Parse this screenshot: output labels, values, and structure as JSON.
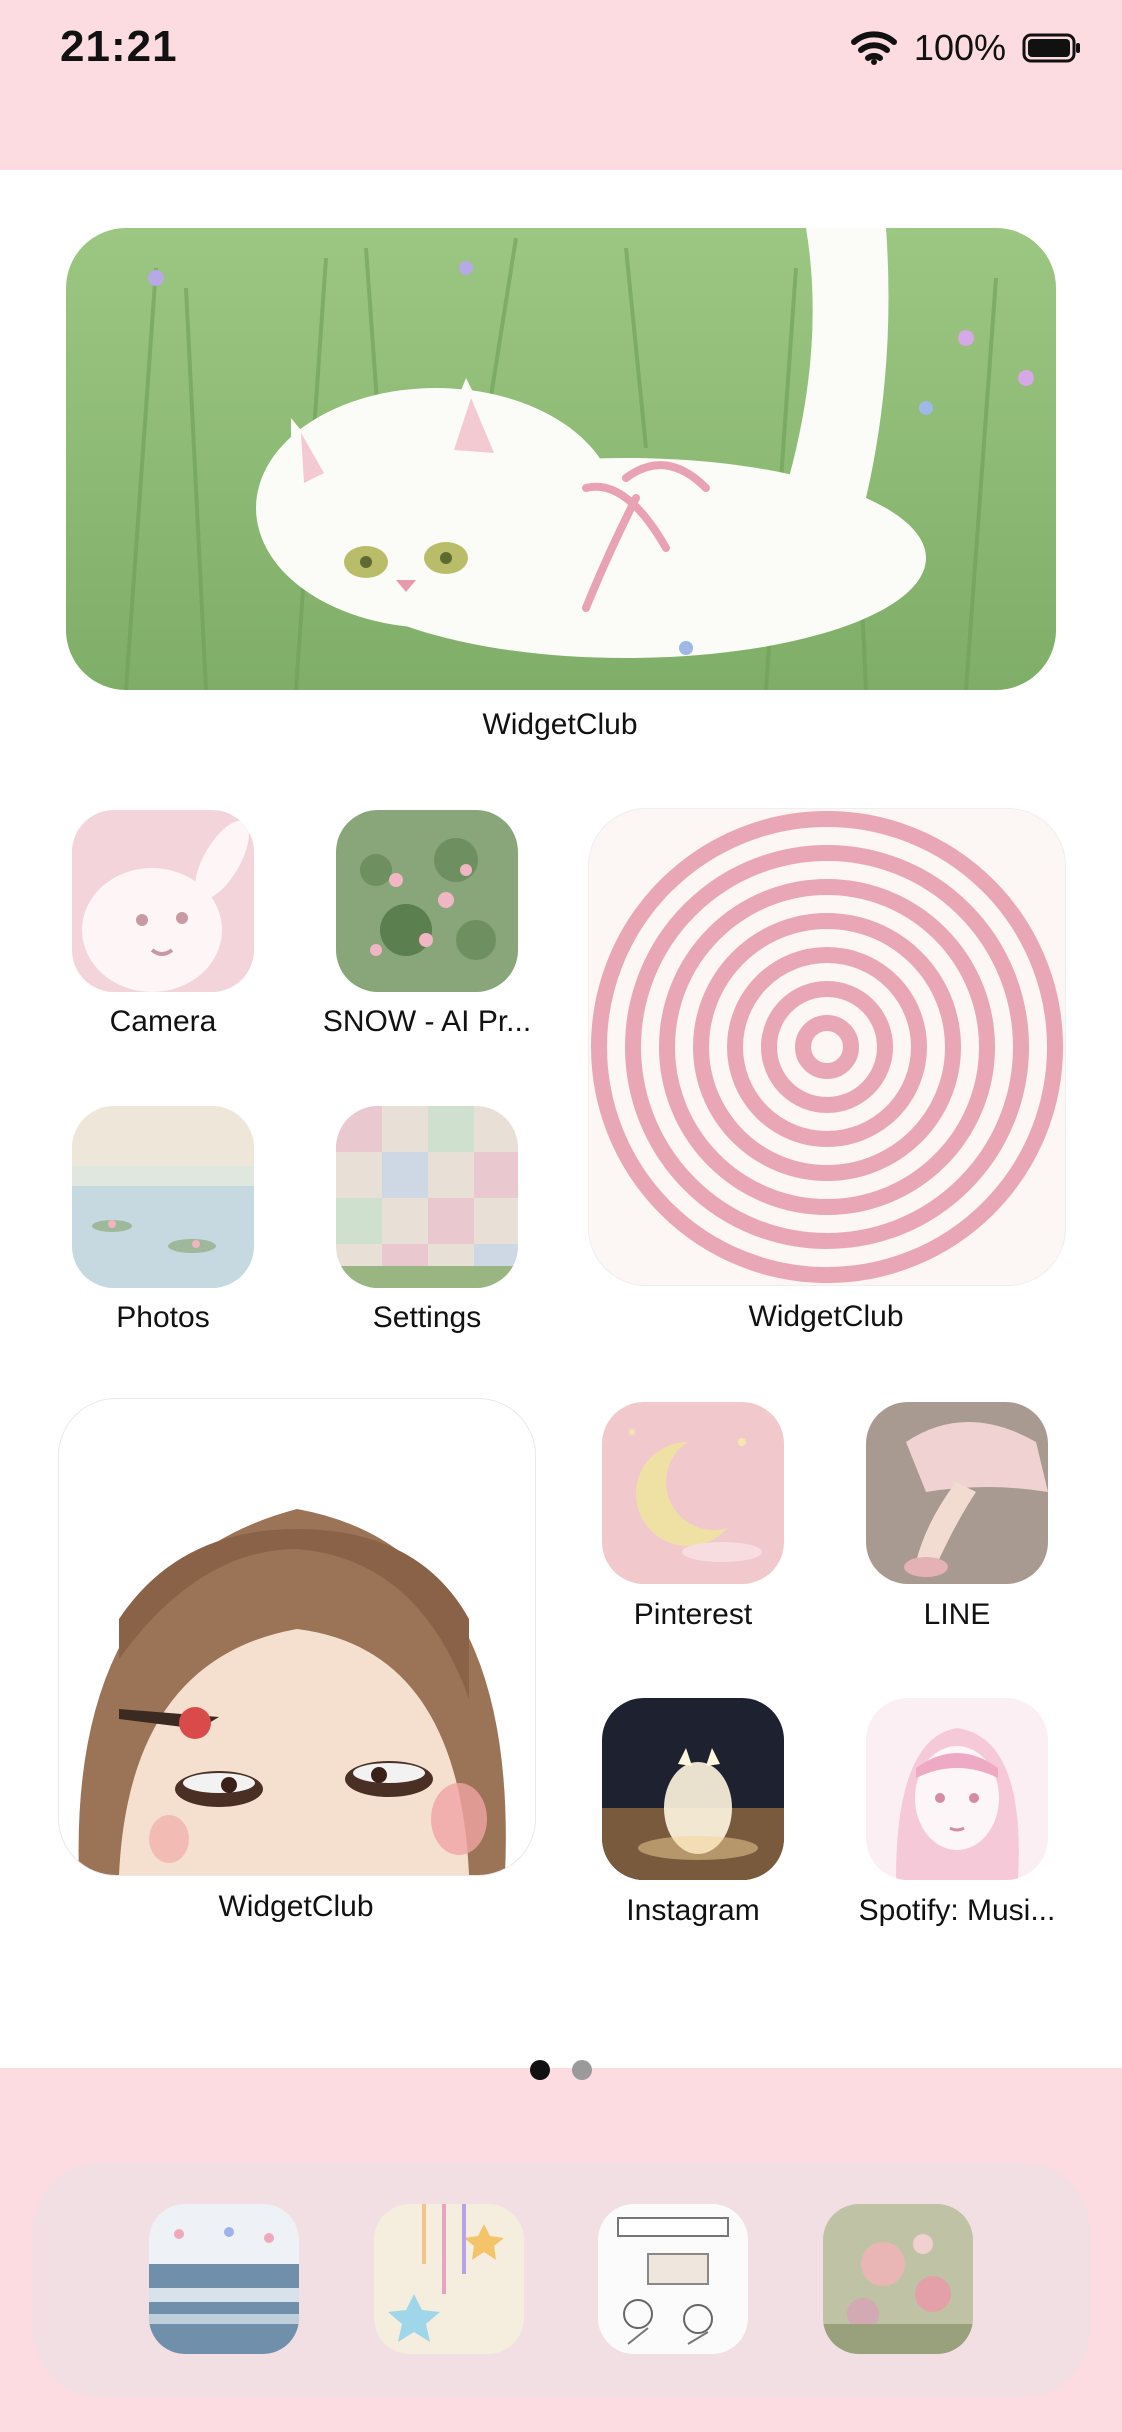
{
  "status_bar": {
    "time": "21:21",
    "battery_percent": "100%"
  },
  "widgets": {
    "cat_widget": {
      "label": "WidgetClub"
    },
    "spiral_widget": {
      "label": "WidgetClub"
    },
    "girl_widget": {
      "label": "WidgetClub"
    }
  },
  "apps": [
    {
      "label": "Camera"
    },
    {
      "label": "SNOW - AI Pr..."
    },
    {
      "label": "Photos"
    },
    {
      "label": "Settings"
    },
    {
      "label": "Pinterest"
    },
    {
      "label": "LINE"
    },
    {
      "label": "Instagram"
    },
    {
      "label": "Spotify: Musi..."
    }
  ],
  "page_indicator": {
    "current": 1,
    "total": 2
  },
  "colors": {
    "band_pink": "#fcdbe1",
    "dock": "#f2dfe3",
    "accent_pink": "#e8a7b7",
    "grass_green": "#8fbf73"
  },
  "dock_icons": [
    "ocean-app-icon",
    "rainbow-stars-app-icon",
    "synchronicity-app-icon",
    "floral-app-icon"
  ]
}
